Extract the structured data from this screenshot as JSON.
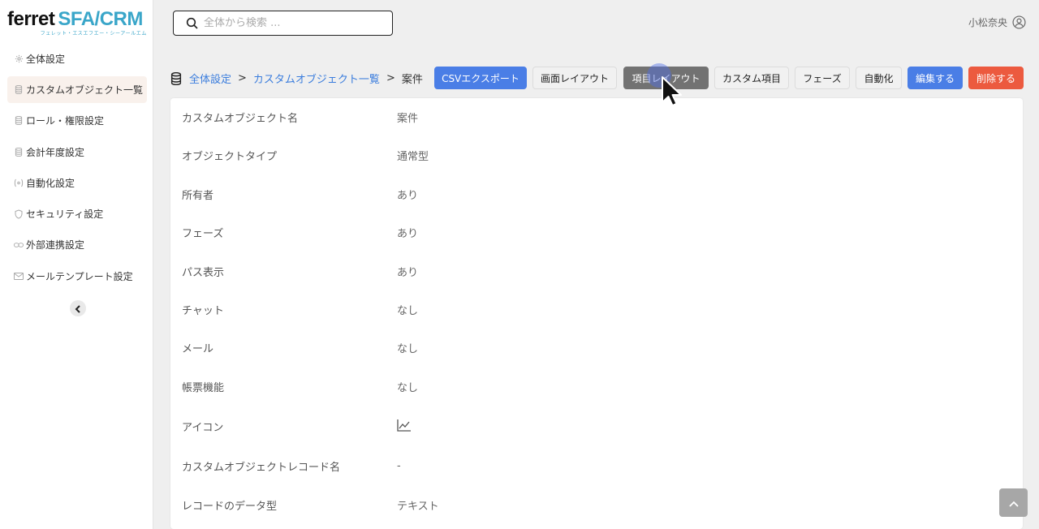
{
  "brand": {
    "logo_main_a": "ferret",
    "logo_main_b": "SFA/CRM",
    "logo_sub": "フェレット・エスエフエー・シーアールエム"
  },
  "search": {
    "placeholder": "全体から検索 ..."
  },
  "user": {
    "name": "小松奈央"
  },
  "sidebar": {
    "items": [
      {
        "label": "全体設定",
        "icon": "gear-icon"
      },
      {
        "label": "カスタムオブジェクト一覧",
        "icon": "database-icon"
      },
      {
        "label": "ロール・権限設定",
        "icon": "database-icon"
      },
      {
        "label": "会計年度設定",
        "icon": "database-icon"
      },
      {
        "label": "自動化設定",
        "icon": "automation-icon"
      },
      {
        "label": "セキュリティ設定",
        "icon": "shield-icon"
      },
      {
        "label": "外部連携設定",
        "icon": "link-icon"
      },
      {
        "label": "メールテンプレート設定",
        "icon": "mail-icon"
      }
    ],
    "active_index": 1
  },
  "breadcrumb": {
    "root": "全体設定",
    "sep": ">",
    "parent": "カスタムオブジェクト一覧",
    "current": "案件"
  },
  "toolbar": {
    "csv_export": "CSVエクスポート",
    "screen_layout": "画面レイアウト",
    "field_layout": "項目レイアウト",
    "custom_fields": "カスタム項目",
    "phases": "フェーズ",
    "automation": "自動化",
    "edit": "編集する",
    "delete": "削除する"
  },
  "details": [
    {
      "label": "カスタムオブジェクト名",
      "value": "案件"
    },
    {
      "label": "オブジェクトタイプ",
      "value": "通常型"
    },
    {
      "label": "所有者",
      "value": "あり"
    },
    {
      "label": "フェーズ",
      "value": "あり"
    },
    {
      "label": "パス表示",
      "value": "あり"
    },
    {
      "label": "チャット",
      "value": "なし"
    },
    {
      "label": "メール",
      "value": "なし"
    },
    {
      "label": "帳票機能",
      "value": "なし"
    },
    {
      "label": "アイコン",
      "value": "",
      "icon": "line-chart-icon"
    },
    {
      "label": "カスタムオブジェクトレコード名",
      "value": "-"
    },
    {
      "label": "レコードのデータ型",
      "value": "テキスト"
    }
  ],
  "colors": {
    "accent_blue": "#4a7ee6",
    "danger_red": "#ec5a3f",
    "link_blue": "#3b7ddd",
    "brand_teal": "#3aa6c9"
  }
}
